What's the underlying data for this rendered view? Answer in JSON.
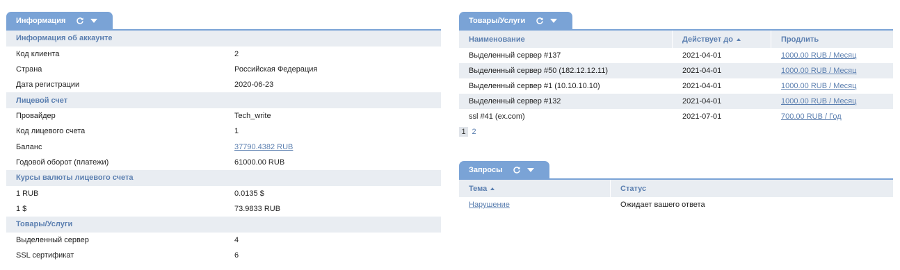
{
  "info_panel": {
    "tab_title": "Информация",
    "sections": {
      "account": {
        "title": "Информация об аккаунте",
        "rows": [
          {
            "key": "Код клиента",
            "value": "2"
          },
          {
            "key": "Страна",
            "value": "Российская Федерация"
          },
          {
            "key": "Дата регистрации",
            "value": "2020-06-23"
          }
        ]
      },
      "personal_account": {
        "title": "Лицевой счет",
        "rows": [
          {
            "key": "Провайдер",
            "value": "Tech_write"
          },
          {
            "key": "Код лицевого счета",
            "value": "1"
          },
          {
            "key": "Баланс",
            "value": "37790.4382 RUB"
          },
          {
            "key": "Годовой оборот (платежи)",
            "value": "61000.00 RUB"
          }
        ]
      },
      "currency": {
        "title": "Курсы валюты лицевого счета",
        "rows": [
          {
            "key": "1 RUB",
            "value": "0.0135 $"
          },
          {
            "key": "1 $",
            "value": "73.9833 RUB"
          }
        ]
      },
      "services": {
        "title": "Товары/Услуги",
        "rows": [
          {
            "key": "Выделенный сервер",
            "value": "4"
          },
          {
            "key": "SSL сертификат",
            "value": "6"
          }
        ]
      }
    }
  },
  "services_panel": {
    "tab_title": "Товары/Услуги",
    "columns": {
      "name": "Наименование",
      "valid_until": "Действует до",
      "renew": "Продлить"
    },
    "rows": [
      {
        "name": "Выделенный сервер #137",
        "valid_until": "2021-04-01",
        "renew": "1000.00 RUB / Месяц"
      },
      {
        "name": "Выделенный сервер #50 (182.12.12.11)",
        "valid_until": "2021-04-01",
        "renew": "1000.00 RUB / Месяц"
      },
      {
        "name": "Выделенный сервер #1 (10.10.10.10)",
        "valid_until": "2021-04-01",
        "renew": "1000.00 RUB / Месяц"
      },
      {
        "name": "Выделенный сервер #132",
        "valid_until": "2021-04-01",
        "renew": "1000.00 RUB / Месяц"
      },
      {
        "name": "ssl #41 (ex.com)",
        "valid_until": "2021-07-01",
        "renew": "700.00 RUB / Год"
      }
    ],
    "pager": {
      "current": "1",
      "other": "2"
    }
  },
  "requests_panel": {
    "tab_title": "Запросы",
    "columns": {
      "theme": "Тема",
      "status": "Статус"
    },
    "rows": [
      {
        "theme": "Нарушение",
        "status": "Ожидает вашего ответа"
      }
    ]
  },
  "icons": {
    "refresh": "refresh-icon",
    "menu": "caret-down-icon"
  },
  "colors": {
    "accent": "#7aa3d6",
    "header_bg": "#e9edf2",
    "header_text": "#5b7fb0",
    "link": "#5b7fb0"
  }
}
